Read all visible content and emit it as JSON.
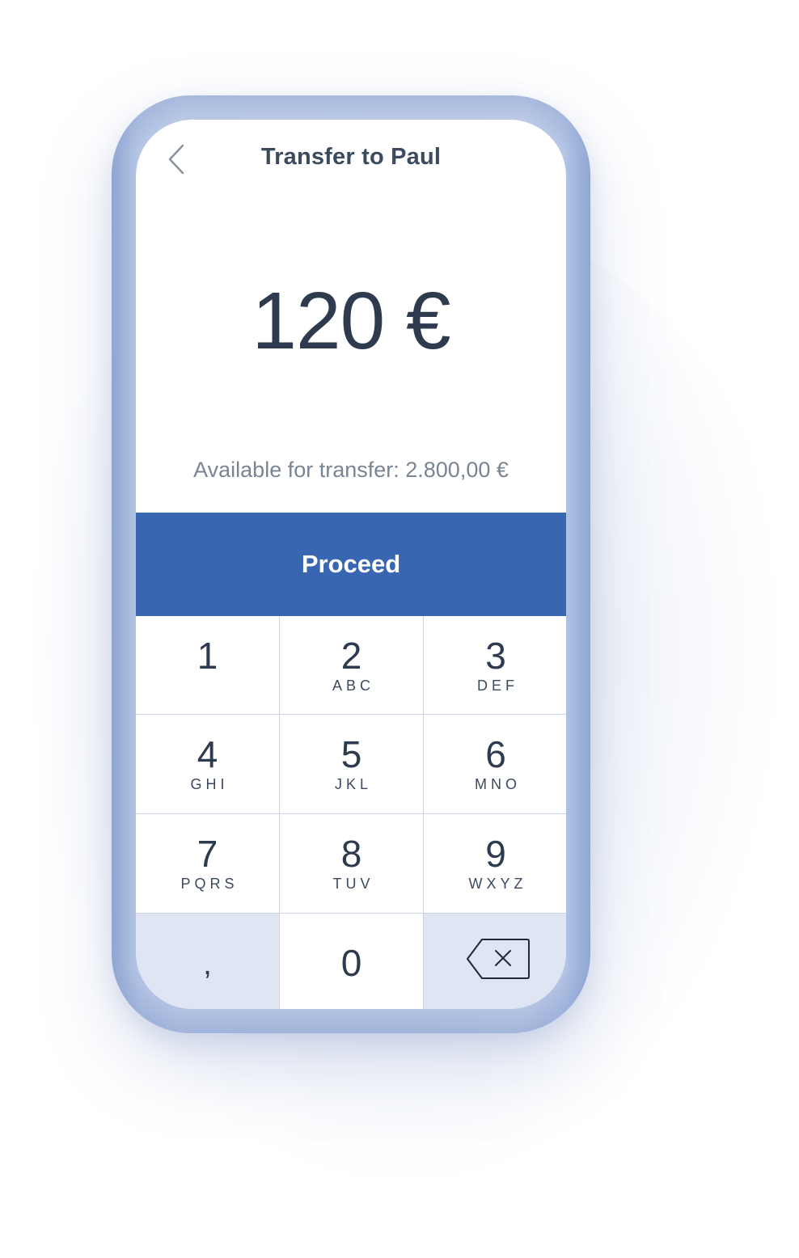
{
  "header": {
    "back_icon": "chevron-left-icon",
    "title": "Transfer to Paul"
  },
  "amount": {
    "display": "120 €"
  },
  "balance": {
    "text": "Available for transfer: 2.800,00 €"
  },
  "proceed": {
    "label": "Proceed"
  },
  "keypad": {
    "keys": [
      {
        "digit": "1",
        "letters": ""
      },
      {
        "digit": "2",
        "letters": "ABC"
      },
      {
        "digit": "3",
        "letters": "DEF"
      },
      {
        "digit": "4",
        "letters": "GHI"
      },
      {
        "digit": "5",
        "letters": "JKL"
      },
      {
        "digit": "6",
        "letters": "MNO"
      },
      {
        "digit": "7",
        "letters": "PQRS"
      },
      {
        "digit": "8",
        "letters": "TUV"
      },
      {
        "digit": "9",
        "letters": "WXYZ"
      }
    ],
    "comma": ",",
    "zero": "0",
    "backspace_icon": "backspace-icon"
  },
  "colors": {
    "accent": "#3866b1",
    "text_dark": "#2e3b4f",
    "text_muted": "#7a8594",
    "key_alt_bg": "#dfe5f2",
    "phone_frame": "#b8c8e6"
  }
}
